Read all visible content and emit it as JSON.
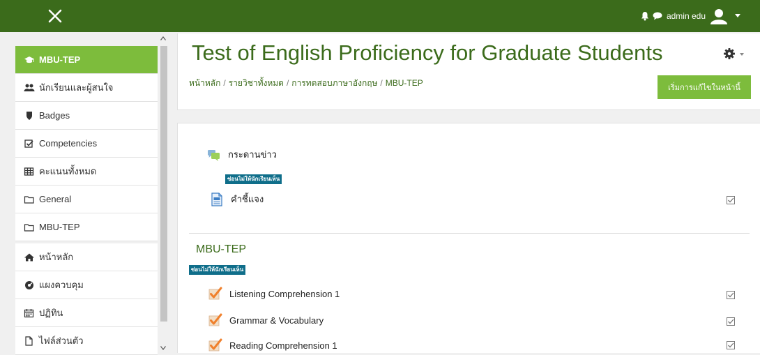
{
  "topbar": {
    "user_name": "admin edu",
    "bg_color": "#3b6b1b",
    "icons": [
      "close-icon",
      "bell-icon",
      "chat-icon",
      "user-avatar-icon",
      "caret-down-icon"
    ]
  },
  "sidebar": {
    "items": [
      {
        "label": "MBU-TEP",
        "icon": "graduation-cap-icon",
        "active": true
      },
      {
        "label": "นักเรียนและผู้สนใจ",
        "icon": "users-icon"
      },
      {
        "label": "Badges",
        "icon": "shield-icon"
      },
      {
        "label": "Competencies",
        "icon": "check-square-icon"
      },
      {
        "label": "คะแนนทั้งหมด",
        "icon": "table-icon"
      },
      {
        "label": "General",
        "icon": "folder-icon"
      },
      {
        "label": "MBU-TEP",
        "icon": "folder-icon"
      },
      {
        "label": "หน้าหลัก",
        "icon": "home-icon"
      },
      {
        "label": "แผงควบคุม",
        "icon": "dashboard-icon"
      },
      {
        "label": "ปฏิทิน",
        "icon": "calendar-icon"
      },
      {
        "label": "ไฟล์ส่วนตัว",
        "icon": "file-icon"
      }
    ],
    "active_color": "#7dbc3c"
  },
  "header": {
    "title": "Test of English Proficiency for Graduate Students",
    "breadcrumb": [
      "หน้าหลัก",
      "รายวิชาทั้งหมด",
      "การทดสอบภาษาอังกฤษ",
      "MBU-TEP"
    ],
    "breadcrumb_sep": "/",
    "edit_button": "เริ่มการแก้ไขในหน้านี้"
  },
  "content": {
    "forum_label": "กระดานข่าว",
    "hidden_badge": "ซ่อนไม่ให้นักเรียนเห็น",
    "instructions_label": "คำชี้แจง",
    "section_title": "MBU-TEP",
    "section_hidden_badge": "ซ่อนไม่ให้นักเรียนเห็น",
    "quizzes": [
      {
        "label": "Listening Comprehension 1"
      },
      {
        "label": "Grammar & Vocabulary"
      },
      {
        "label": "Reading Comprehension 1"
      }
    ],
    "badge_color": "#0f6e8a"
  }
}
